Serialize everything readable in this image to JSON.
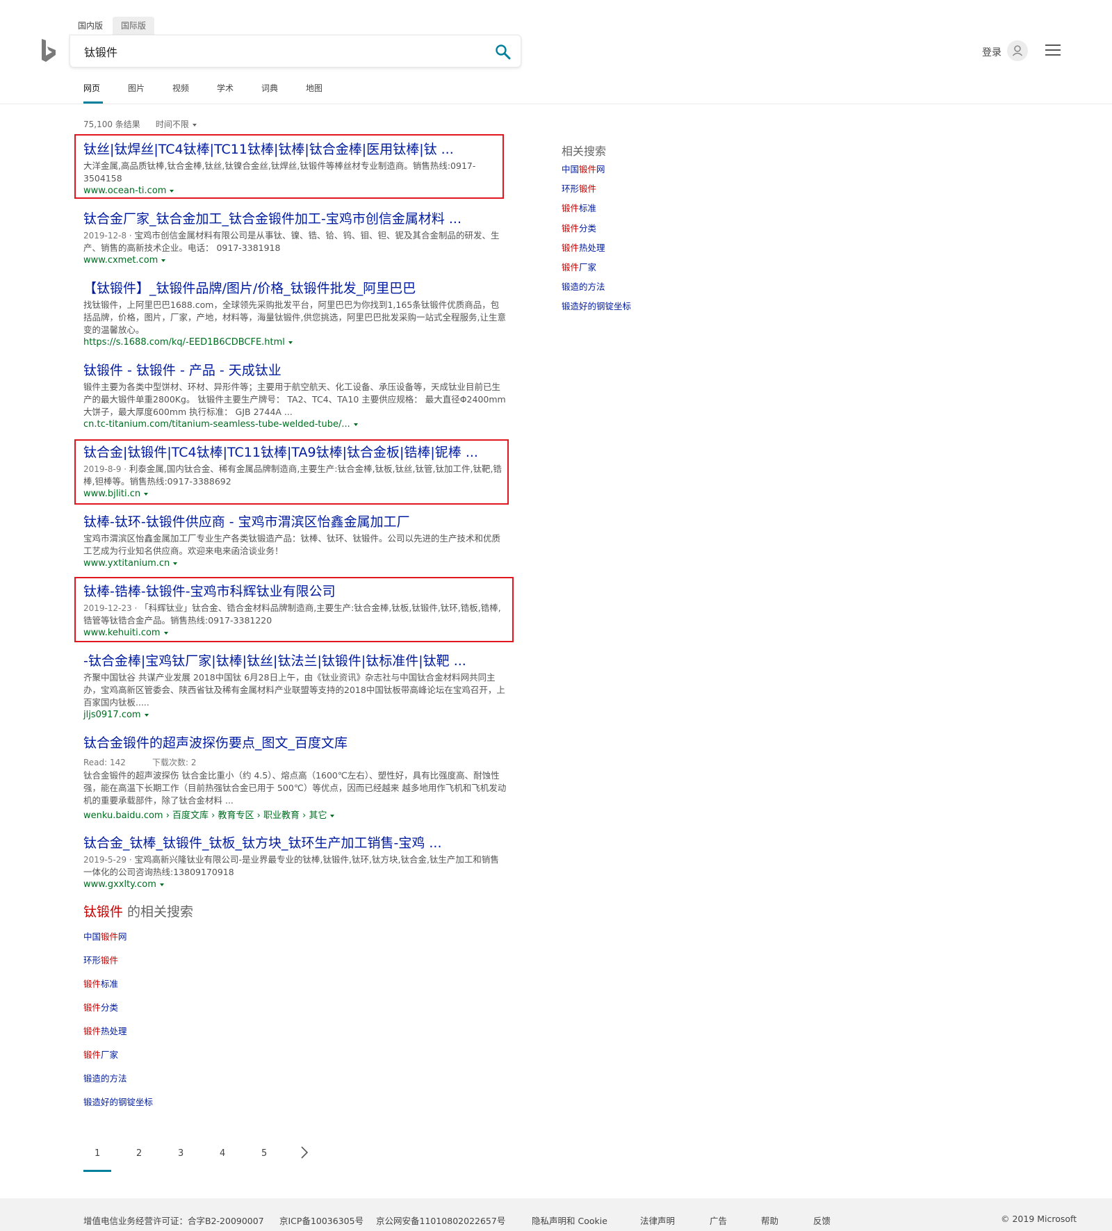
{
  "colors": {
    "accent": "#00809d",
    "title_blue": "#001ba0",
    "url_green": "#006d21",
    "highlight_red": "#c80000",
    "annotation_box": "#e0171e"
  },
  "header": {
    "region_tabs": [
      "国内版",
      "国际版"
    ],
    "search": {
      "value": "钛锻件"
    },
    "login": "登录",
    "icons": {
      "logo": "bing-logo-icon",
      "search": "search-icon",
      "avatar": "user-avatar-icon",
      "menu": "hamburger-menu-icon"
    }
  },
  "nav": [
    "网页",
    "图片",
    "视频",
    "学术",
    "词典",
    "地图"
  ],
  "meta": {
    "count": "75,100 条结果",
    "time_filter": "时间不限"
  },
  "results": [
    {
      "title": "钛丝|钛焊丝|TC4钛棒|TC11钛棒|钛棒|钛合金棒|医用钛棒|钛 ...",
      "meta": "",
      "snippet": "大洋金属,高品质钛棒,钛合金棒,钛丝,钛镍合金丝,钛焊丝,钛锻件等棒丝材专业制造商。销售热线:0917-3504158",
      "url": "www.ocean-ti.com"
    },
    {
      "title": "钛合金厂家_钛合金加工_钛合金锻件加工-宝鸡市创信金属材料 ...",
      "meta": "2019-12-8 · ",
      "snippet": "宝鸡市创信金属材料有限公司是从事钛、镍、锆、铪、钨、钼、钽、铌及其合金制品的研发、生产、销售的高新技术企业。电话： 0917-3381918",
      "url": "www.cxmet.com"
    },
    {
      "title": "【钛锻件】_钛锻件品牌/图片/价格_钛锻件批发_阿里巴巴",
      "meta": "",
      "snippet": "找钛锻件，上阿里巴巴1688.com，全球领先采购批发平台，阿里巴巴为你找到1,165条钛锻件优质商品，包括品牌，价格，图片，厂家，产地，材料等，海量钛锻件,供您挑选，阿里巴巴批发采购一站式全程服务,让生意变的温馨放心。",
      "url": "https://s.1688.com/kq/-EED1B6CDBCFE.html"
    },
    {
      "title": "钛锻件 - 钛锻件 - 产品 - 天成钛业",
      "meta": "",
      "snippet": "锻件主要为各类中型饼材、环材、异形件等；主要用于航空航天、化工设备、承压设备等，天成钛业目前已生产的最大锻件单重2800Kg。 钛锻件主要生产牌号： TA2、TC4、TA10 主要供应规格： 最大直径Φ2400mm大饼子，最大厚度600mm 执行标准： GJB 2744A ...",
      "url": "cn.tc-titanium.com/titanium-seamless-tube-welded-tube/..."
    },
    {
      "title": "钛合金|钛锻件|TC4钛棒|TC11钛棒|TA9钛棒|钛合金板|锆棒|铌棒 ...",
      "meta": "2019-8-9 · ",
      "snippet": "利泰金属,国内钛合金、稀有金属品牌制造商,主要生产:钛合金棒,钛板,钛丝,钛管,钛加工件,钛靶,锆棒,钽棒等。销售热线:0917-3388692",
      "url": "www.bjliti.cn"
    },
    {
      "title": "钛棒-钛环-钛锻件供应商 - 宝鸡市渭滨区怡鑫金属加工厂",
      "meta": "",
      "snippet": "宝鸡市渭滨区怡鑫金属加工厂专业生产各类钛锻造产品：钛棒、钛环、钛锻件。公司以先进的生产技术和优质工艺成为行业知名供应商。欢迎来电来函洽谈业务！",
      "url": "www.yxtitanium.cn"
    },
    {
      "title": "钛棒-锆棒-钛锻件-宝鸡市科辉钛业有限公司",
      "meta": "2019-12-23 · ",
      "snippet": "「科辉钛业」钛合金、锆合金材料品牌制造商,主要生产:钛合金棒,钛板,钛锻件,钛环,锆板,锆棒,锆管等钛锆合金产品。销售热线:0917-3381220",
      "url": "www.kehuiti.com"
    },
    {
      "title": "-钛合金棒|宝鸡钛厂家|钛棒|钛丝|钛法兰|钛锻件|钛标准件|钛靶 ...",
      "meta": "",
      "snippet": "齐聚中国钛谷 共谋产业发展 2018中国钛 6月28日上午，由《钛业资讯》杂志社与中国钛合金材料网共同主办，宝鸡高新区管委会、陕西省钛及稀有金属材料产业联盟等支持的2018中国钛板带高峰论坛在宝鸡召开，上百家国内钛板.....",
      "url": "jljs0917.com"
    },
    {
      "title": "钛合金锻件的超声波探伤要点_图文_百度文库",
      "meta": "Read: 142          下载次数: 2",
      "snippet": "钛合金锻件的超声波探伤 钛合金比重小（约 4.5）、熔点高（1600℃左右）、塑性好，具有比强度高、耐蚀性 强，能在高温下长期工作（目前热强钛合金已用于 500℃）等优点，因而已经越来 越多地用作飞机和飞机发动机的重要承载部件，除了钛合金材料 ...",
      "url": "wenku.baidu.com › 百度文库 › 教育专区 › 职业教育 › 其它"
    },
    {
      "title": "钛合金_钛棒_钛锻件_钛板_钛方块_钛环生产加工销售-宝鸡 ...",
      "meta": "2019-5-29 · ",
      "snippet": "宝鸡高新兴隆钛业有限公司-是业界最专业的钛棒,钛锻件,钛环,钛方块,钛合金,钛生产加工和销售一体化的公司咨询热线:13809170918",
      "url": "www.gxxlty.com"
    }
  ],
  "sidebar": {
    "title": "相关搜索",
    "items": [
      [
        {
          "t": "中国",
          "c": "blue"
        },
        {
          "t": "锻件",
          "c": "red"
        },
        {
          "t": "网",
          "c": "blue"
        }
      ],
      [
        {
          "t": "环形",
          "c": "blue"
        },
        {
          "t": "锻件",
          "c": "red"
        }
      ],
      [
        {
          "t": "锻件",
          "c": "red"
        },
        {
          "t": "标准",
          "c": "blue"
        }
      ],
      [
        {
          "t": "锻件",
          "c": "red"
        },
        {
          "t": "分类",
          "c": "blue"
        }
      ],
      [
        {
          "t": "锻件",
          "c": "red"
        },
        {
          "t": "热处理",
          "c": "blue"
        }
      ],
      [
        {
          "t": "锻件",
          "c": "red"
        },
        {
          "t": "厂家",
          "c": "blue"
        }
      ],
      [
        {
          "t": "锻造的方法",
          "c": "blue"
        }
      ],
      [
        {
          "t": "锻造好的钢锭坐标",
          "c": "blue"
        }
      ]
    ]
  },
  "related_bottom": {
    "highlight": "钛锻件",
    "suffix": " 的相关搜索"
  },
  "pagination": {
    "pages": [
      "1",
      "2",
      "3",
      "4",
      "5"
    ],
    "active": "1"
  },
  "footer": {
    "license": "增值电信业务经营许可证：合字B2-20090007",
    "icp": "京ICP备10036305号",
    "police": "京公网安备11010802022657号",
    "privacy": "隐私声明和 Cookie",
    "legal": "法律声明",
    "ads": "广告",
    "help": "帮助",
    "feedback": "反馈",
    "copyright": "© 2019 Microsoft"
  }
}
